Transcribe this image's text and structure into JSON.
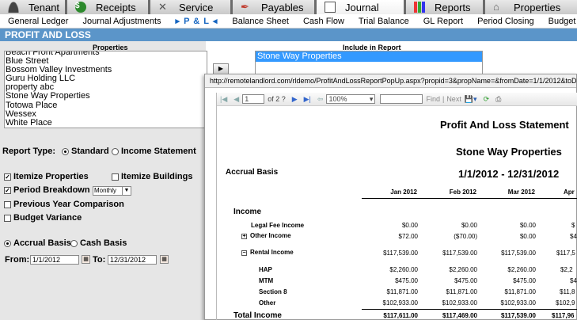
{
  "tabs": [
    {
      "label": "Tenant",
      "icon": "person-icon"
    },
    {
      "label": "Receipts",
      "icon": "coin-icon"
    },
    {
      "label": "Service",
      "icon": "wrench-icon"
    },
    {
      "label": "Payables",
      "icon": "quill-icon"
    },
    {
      "label": "Journal",
      "icon": "book-icon"
    },
    {
      "label": "Reports",
      "icon": "chart-icon"
    },
    {
      "label": "Properties",
      "icon": "house-icon"
    }
  ],
  "subnav": [
    "General Ledger",
    "Journal Adjustments",
    "P & L",
    "Balance Sheet",
    "Cash Flow",
    "Trial Balance",
    "GL Report",
    "Period Closing",
    "Budget"
  ],
  "section_title": "PROFIT AND LOSS",
  "properties_header": "Properties",
  "include_header": "Include in Report",
  "properties": [
    "Beach Front Apartments",
    "Blue Street",
    "Bossom Valley Investments",
    "Guru Holding LLC",
    "property abc",
    "Stone Way Properties",
    "Totowa Place",
    "Wessex",
    "White Place"
  ],
  "included": [
    "Stone Way Properties"
  ],
  "report_type_label": "Report Type:",
  "report_type_standard": "Standard",
  "report_type_income": "Income Statement",
  "itemize_properties": "Itemize Properties",
  "itemize_buildings": "Itemize Buildings",
  "period_breakdown": "Period Breakdown",
  "period_value": "Monthly",
  "prev_year": "Previous Year Comparison",
  "budget_variance": "Budget Variance",
  "accrual_basis": "Accrual Basis",
  "cash_basis": "Cash Basis",
  "from_label": "From:",
  "to_label": "To:",
  "from_date": "1/1/2012",
  "to_date": "12/31/2012",
  "popup": {
    "url": "http://remotelandlord.com/rldemo/ProfitAndLossReportPopUp.aspx?propid=3&propName=&fromDate=1/1/2012&toDate=12/31/2012&Basis=Accrual",
    "page": "1",
    "page_of": "of 2 ?",
    "zoom": "100%",
    "find": "Find",
    "next": "Next"
  },
  "report": {
    "title": "Profit And Loss Statement",
    "property": "Stone Way Properties",
    "basis": "Accrual Basis",
    "period": "1/1/2012 - 12/31/2012",
    "months": [
      "Jan  2012",
      "Feb  2012",
      "Mar  2012",
      "Apr"
    ],
    "income_label": "Income",
    "rows": [
      {
        "label": "Legal Fee Income",
        "vals": [
          "$0.00",
          "$0.00",
          "$0.00",
          "$"
        ]
      },
      {
        "label": "Other Income",
        "vals": [
          "$72.00",
          "($70.00)",
          "$0.00",
          "$4"
        ],
        "expander": "+"
      },
      {
        "label": "Rental Income",
        "vals": [
          "$117,539.00",
          "$117,539.00",
          "$117,539.00",
          "$117,5"
        ],
        "expander": "−"
      },
      {
        "label": "HAP",
        "vals": [
          "$2,260.00",
          "$2,260.00",
          "$2,260.00",
          "$2,2"
        ]
      },
      {
        "label": "MTM",
        "vals": [
          "$475.00",
          "$475.00",
          "$475.00",
          "$4"
        ]
      },
      {
        "label": "Section 8",
        "vals": [
          "$11,871.00",
          "$11,871.00",
          "$11,871.00",
          "$11,8"
        ]
      },
      {
        "label": "Other",
        "vals": [
          "$102,933.00",
          "$102,933.00",
          "$102,933.00",
          "$102,9"
        ]
      }
    ],
    "total_label": "Total Income",
    "total_vals": [
      "$117,611.00",
      "$117,469.00",
      "$117,539.00",
      "$117,96"
    ]
  }
}
